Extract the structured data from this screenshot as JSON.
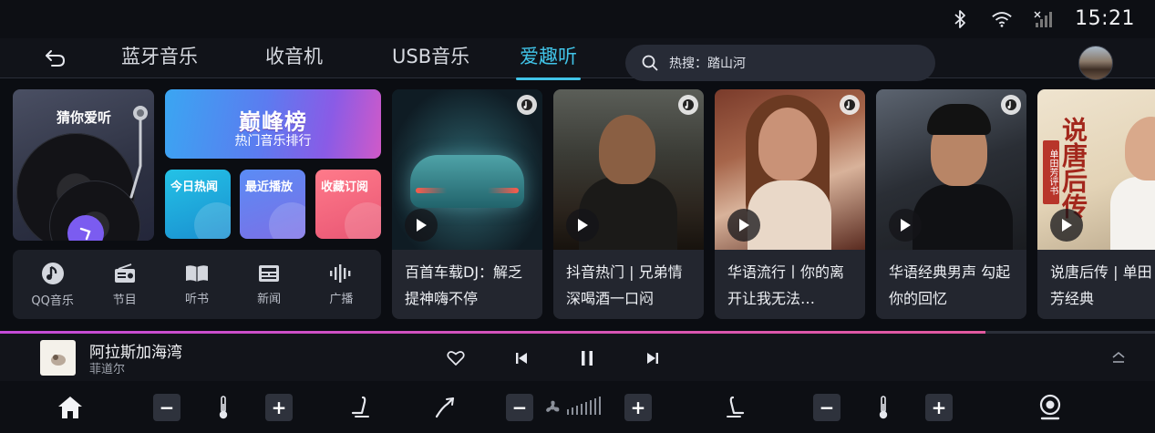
{
  "status": {
    "time": "15:21",
    "icons": [
      "bluetooth-icon",
      "wifi-icon",
      "signal-icon"
    ]
  },
  "tabs": [
    {
      "label": "蓝牙音乐"
    },
    {
      "label": "收音机"
    },
    {
      "label": "USB音乐"
    },
    {
      "label": "爱趣听",
      "active": true
    }
  ],
  "search": {
    "text": "热搜：踏山河"
  },
  "guess": {
    "title": "猜你爱听"
  },
  "rank": {
    "logo": "巅峰榜",
    "subtitle": "热门音乐排行"
  },
  "quick": [
    {
      "label": "今日热闻"
    },
    {
      "label": "最近播放"
    },
    {
      "label": "收藏订阅"
    }
  ],
  "categories": [
    {
      "label": "QQ音乐",
      "icon": "qq-music-icon"
    },
    {
      "label": "节目",
      "icon": "radio-icon"
    },
    {
      "label": "听书",
      "icon": "book-icon"
    },
    {
      "label": "新闻",
      "icon": "news-icon"
    },
    {
      "label": "广播",
      "icon": "broadcast-icon"
    }
  ],
  "albums": [
    {
      "title": "百首车载DJ：解乏提神嗨不停"
    },
    {
      "title": "抖音热门 | 兄弟情深喝酒一口闷"
    },
    {
      "title": "华语流行丨你的离开让我无法…"
    },
    {
      "title": "华语经典男声 勾起你的回忆"
    },
    {
      "title": "说唐后传 | 单田芳经典",
      "cover_text": "说唐后传",
      "seal_text": "单田芳评书"
    }
  ],
  "player": {
    "title": "阿拉斯加海湾",
    "artist": "菲道尔",
    "progress": 0.853
  },
  "climate": {
    "minus": "−",
    "plus": "+"
  },
  "colors": {
    "accent": "#41c4e8",
    "progress": "#c44bd8",
    "background": "#0b0d12"
  }
}
